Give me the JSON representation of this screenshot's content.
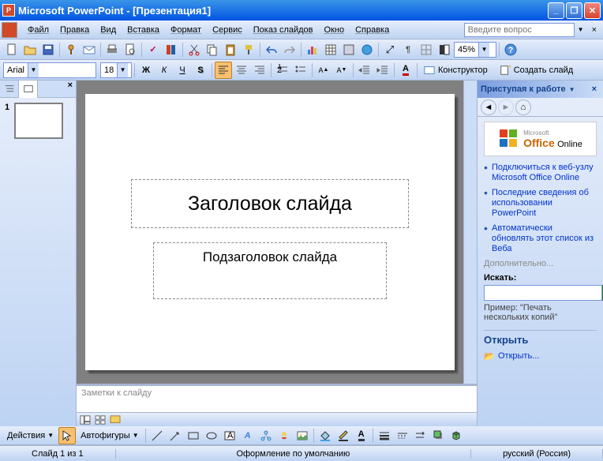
{
  "title": "Microsoft PowerPoint - [Презентация1]",
  "menu": {
    "file": "Файл",
    "edit": "Правка",
    "view": "Вид",
    "insert": "Вставка",
    "format": "Формат",
    "tools": "Сервис",
    "slideshow": "Показ слайдов",
    "window": "Окно",
    "help": "Справка",
    "help_placeholder": "Введите вопрос"
  },
  "toolbar1": {
    "zoom": "45%"
  },
  "toolbar2": {
    "font": "Arial",
    "size": "18",
    "designer": "Конструктор",
    "new_slide": "Создать слайд"
  },
  "thumbs": {
    "slide_num": "1"
  },
  "slide": {
    "title": "Заголовок слайда",
    "subtitle": "Подзаголовок слайда"
  },
  "notes": {
    "placeholder": "Заметки к слайду"
  },
  "taskpane": {
    "title": "Приступая к работе",
    "logo_sup": "Microsoft",
    "logo_main": "Office",
    "logo_suffix": "Online",
    "links": [
      "Подключиться к веб-узлу Microsoft Office Online",
      "Последние сведения об использовании PowerPoint",
      "Автоматически обновлять этот список из Веба"
    ],
    "more": "Дополнительно...",
    "search_label": "Искать:",
    "example_label": "Пример:",
    "example_text": "\"Печать нескольких копий\"",
    "open_header": "Открыть",
    "open_link": "Открыть..."
  },
  "drawing": {
    "actions": "Действия",
    "autoshapes": "Автофигуры"
  },
  "status": {
    "slide": "Слайд 1 из 1",
    "design": "Оформление по умолчанию",
    "lang": "русский (Россия)"
  }
}
